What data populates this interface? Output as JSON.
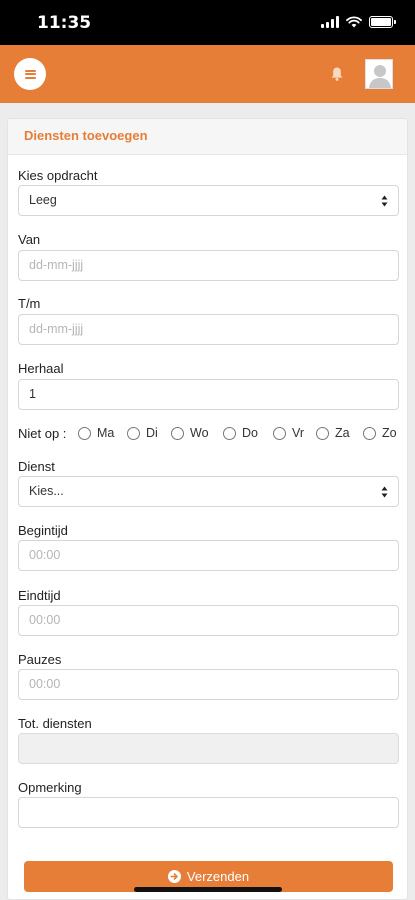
{
  "status_bar": {
    "time": "11:35"
  },
  "header": {
    "menu_icon": "hamburger-menu-icon",
    "bell_icon": "bell-icon",
    "avatar_icon": "user-avatar-icon"
  },
  "form": {
    "title": "Diensten toevoegen",
    "assignment": {
      "label": "Kies opdracht",
      "value": "Leeg"
    },
    "from": {
      "label": "Van",
      "placeholder": "dd-mm-jjjj"
    },
    "until": {
      "label": "T/m",
      "placeholder": "dd-mm-jjjj"
    },
    "repeat": {
      "label": "Herhaal",
      "value": "1"
    },
    "not_on": {
      "label": "Niet op :",
      "days": [
        "Ma",
        "Di",
        "Wo",
        "Do",
        "Vr",
        "Za",
        "Zo"
      ]
    },
    "shift": {
      "label": "Dienst",
      "value": "Kies..."
    },
    "start_time": {
      "label": "Begintijd",
      "placeholder": "00:00"
    },
    "end_time": {
      "label": "Eindtijd",
      "placeholder": "00:00"
    },
    "breaks": {
      "label": "Pauzes",
      "placeholder": "00:00"
    },
    "total_shifts": {
      "label": "Tot. diensten",
      "value": ""
    },
    "remark": {
      "label": "Opmerking",
      "value": ""
    },
    "submit_label": "Verzenden"
  },
  "colors": {
    "accent": "#e67e37",
    "card_header_bg": "#f6f6f6"
  }
}
